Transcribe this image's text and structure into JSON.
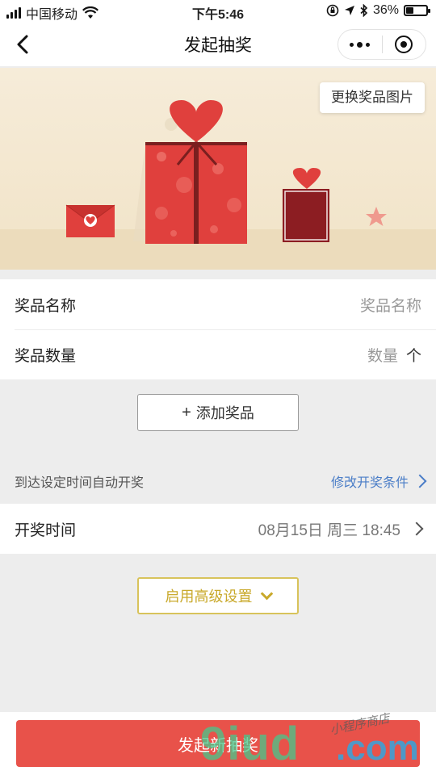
{
  "status_bar": {
    "carrier": "中国移动",
    "time": "下午5:46",
    "battery": "36%",
    "battery_level": 0.36
  },
  "nav": {
    "title": "发起抽奖"
  },
  "banner": {
    "change_image_label": "更换奖品图片"
  },
  "prize_form": {
    "name_label": "奖品名称",
    "name_placeholder": "奖品名称",
    "quantity_label": "奖品数量",
    "quantity_placeholder": "数量",
    "quantity_unit": "个"
  },
  "add_prize_button": "添加奖品",
  "draw_condition": {
    "text": "到达设定时间自动开奖",
    "link": "修改开奖条件"
  },
  "draw_time": {
    "label": "开奖时间",
    "value": "08月15日 周三 18:45"
  },
  "advanced_button": "启用高级设置",
  "launch_button": "发起新抽奖",
  "watermark": {
    "big": "9iud",
    "dot": ".com",
    "small": "小程序商店"
  },
  "colors": {
    "primary_red": "#e8524a",
    "link_blue": "#4a7dc7",
    "gold": "#c9a92b"
  }
}
